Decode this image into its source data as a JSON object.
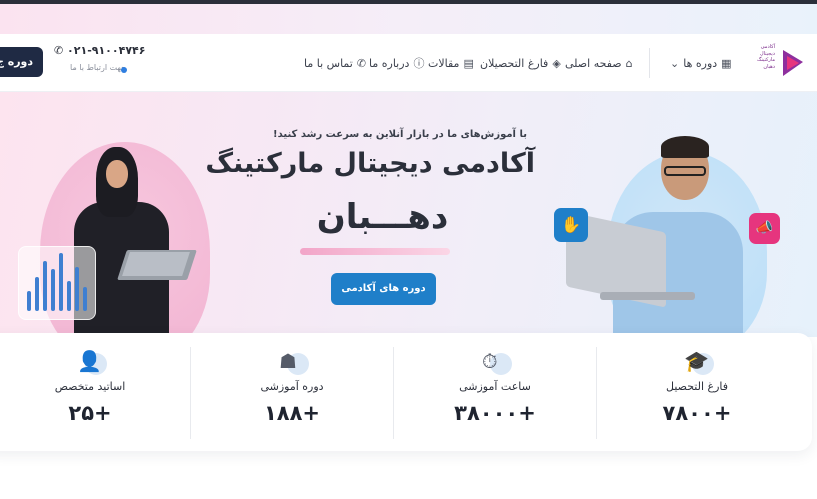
{
  "brand": {
    "logo_text": "آکادمی دیجیتال مارکتینگ دهبان",
    "colors": {
      "primary": "#1f7fc9",
      "dark": "#1f2a44",
      "pink": "#e6357e"
    }
  },
  "header": {
    "nav": [
      {
        "label": "دوره ها",
        "icon": "grid-icon"
      },
      {
        "label": "صفحه اصلی",
        "icon": "home-icon"
      },
      {
        "label": "فارغ التحصیلان",
        "icon": "graduation-icon"
      },
      {
        "label": "مقالات",
        "icon": "article-icon"
      },
      {
        "label": "درباره ما",
        "icon": "info-icon"
      },
      {
        "label": "تماس با ما",
        "icon": "phone-icon"
      }
    ],
    "phone": "۰۲۱-۹۱۰۰۴۷۴۶",
    "contact_caption": "جهت ارتباط با ما",
    "cta_label": "دوره ج"
  },
  "hero": {
    "tagline": "با آموزش‌های ما در بازار آنلاین به سرعت رشد کنید!",
    "title_line1": "آکادمی دیجیتال مارکتینگ",
    "title_line2": "دهـــبان",
    "button_label": "دوره های آکادمی"
  },
  "stats": [
    {
      "label": "فارغ التحصیل",
      "value": "+۷۸۰۰",
      "icon": "graduation-cap-icon"
    },
    {
      "label": "ساعت آموزشی",
      "value": "+۳۸۰۰۰",
      "icon": "stopwatch-icon"
    },
    {
      "label": "دوره آموزشی",
      "value": "+۱۸۸",
      "icon": "course-icon"
    },
    {
      "label": "اساتید متخصص",
      "value": "+۲۵",
      "icon": "instructor-icon"
    }
  ]
}
